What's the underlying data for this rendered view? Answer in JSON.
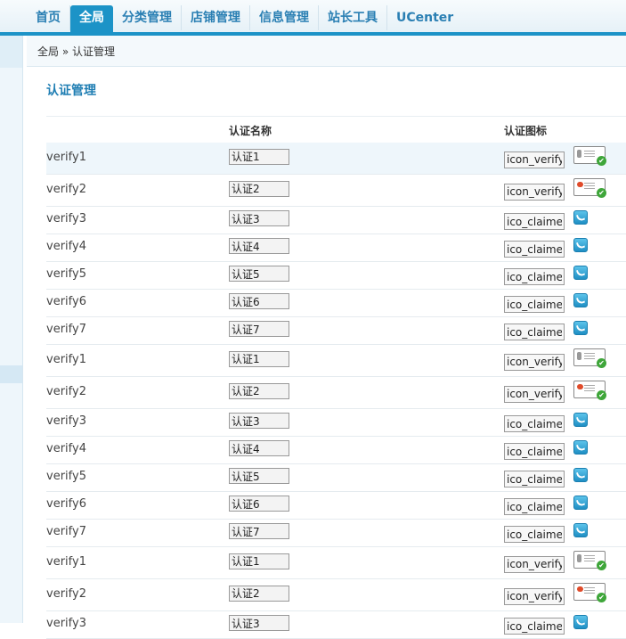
{
  "nav": {
    "tabs": [
      {
        "label": "首页",
        "active": false
      },
      {
        "label": "全局",
        "active": true
      },
      {
        "label": "分类管理",
        "active": false
      },
      {
        "label": "店铺管理",
        "active": false
      },
      {
        "label": "信息管理",
        "active": false
      },
      {
        "label": "站长工具",
        "active": false
      },
      {
        "label": "UCenter",
        "active": false
      }
    ]
  },
  "breadcrumb": "全局 » 认证管理",
  "page_title": "认证管理",
  "table": {
    "headers": {
      "name": "认证名称",
      "icon": "认证图标"
    },
    "rows": [
      {
        "key": "verify1",
        "name": "认证1",
        "icon": "icon_verify",
        "img": "id-card-icon"
      },
      {
        "key": "verify2",
        "name": "认证2",
        "icon": "icon_verify",
        "img": "business-license-icon"
      },
      {
        "key": "verify3",
        "name": "认证3",
        "icon": "ico_claimed",
        "img": "phone-icon"
      },
      {
        "key": "verify4",
        "name": "认证4",
        "icon": "ico_claimed",
        "img": "phone-icon"
      },
      {
        "key": "verify5",
        "name": "认证5",
        "icon": "ico_claimed",
        "img": "phone-icon"
      },
      {
        "key": "verify6",
        "name": "认证6",
        "icon": "ico_claimed",
        "img": "phone-icon"
      },
      {
        "key": "verify7",
        "name": "认证7",
        "icon": "ico_claimed",
        "img": "phone-icon"
      },
      {
        "key": "verify1",
        "name": "认证1",
        "icon": "icon_verify",
        "img": "id-card-icon"
      },
      {
        "key": "verify2",
        "name": "认证2",
        "icon": "icon_verify",
        "img": "business-license-icon"
      },
      {
        "key": "verify3",
        "name": "认证3",
        "icon": "ico_claimed",
        "img": "phone-icon"
      },
      {
        "key": "verify4",
        "name": "认证4",
        "icon": "ico_claimed",
        "img": "phone-icon"
      },
      {
        "key": "verify5",
        "name": "认证5",
        "icon": "ico_claimed",
        "img": "phone-icon"
      },
      {
        "key": "verify6",
        "name": "认证6",
        "icon": "ico_claimed",
        "img": "phone-icon"
      },
      {
        "key": "verify7",
        "name": "认证7",
        "icon": "ico_claimed",
        "img": "phone-icon"
      },
      {
        "key": "verify1",
        "name": "认证1",
        "icon": "icon_verify",
        "img": "id-card-icon"
      },
      {
        "key": "verify2",
        "name": "认证2",
        "icon": "icon_verify",
        "img": "business-license-icon"
      },
      {
        "key": "verify3",
        "name": "认证3",
        "icon": "ico_claimed",
        "img": "phone-icon"
      }
    ]
  },
  "colors": {
    "accent": "#1c93c7",
    "title": "#1f7eb3"
  }
}
